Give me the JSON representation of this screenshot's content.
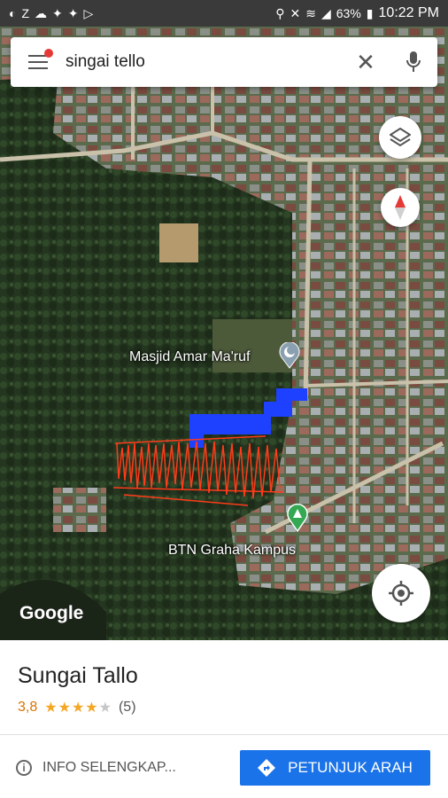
{
  "status_bar": {
    "time": "10:22 PM",
    "battery": "63%",
    "left_icons": [
      "data-saver-icon",
      "z-icon",
      "cloud-icon",
      "twitter-icon",
      "twitter-icon",
      "play-icon"
    ],
    "right_icons": [
      "location-icon",
      "mute-icon",
      "wifi-icon",
      "signal-icon",
      "battery-icon"
    ]
  },
  "search": {
    "query": "singai tello"
  },
  "map": {
    "labels": {
      "mosque": "Masjid Amar Ma'ruf",
      "housing": "BTN Graha Kampus"
    },
    "logo": "Google",
    "colors": {
      "route_blue": "#1e40ff",
      "drawing_red": "#ff3b1a",
      "poi_green": "#34a853"
    }
  },
  "place": {
    "name": "Sungai Tallo",
    "rating": "3,8",
    "rating_value": 3.8,
    "review_count": "(5)"
  },
  "actions": {
    "info": "INFO SELENGKAP...",
    "directions": "PETUNJUK ARAH"
  },
  "accent_color": "#1a73e8"
}
